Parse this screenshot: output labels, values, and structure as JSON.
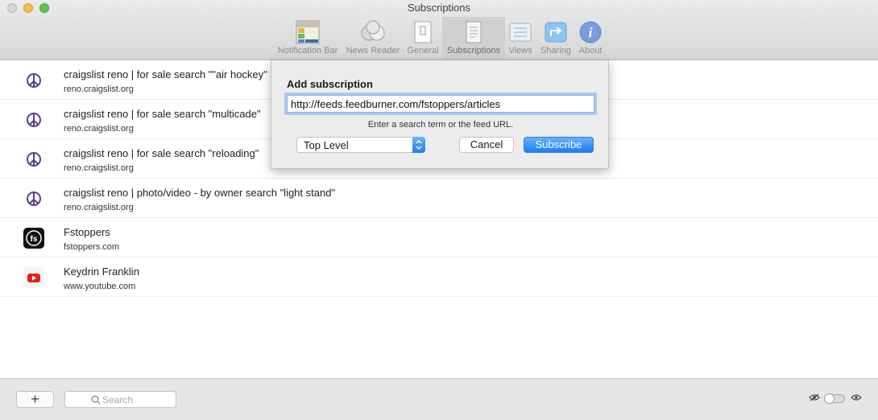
{
  "window": {
    "title": "Subscriptions"
  },
  "toolbar": {
    "items": [
      {
        "label": "Notification Bar",
        "icon": "notification-bar-icon"
      },
      {
        "label": "News Reader",
        "icon": "news-reader-icon"
      },
      {
        "label": "General",
        "icon": "general-icon"
      },
      {
        "label": "Subscriptions",
        "icon": "subscriptions-icon",
        "active": true
      },
      {
        "label": "Views",
        "icon": "views-icon"
      },
      {
        "label": "Sharing",
        "icon": "sharing-icon"
      },
      {
        "label": "About",
        "icon": "info-icon"
      }
    ]
  },
  "subscriptions": [
    {
      "title": "craigslist reno | for sale search \"\"air hockey\"",
      "domain": "reno.craigslist.org",
      "icon": "peace-icon"
    },
    {
      "title": "craigslist reno | for sale search \"multicade\"",
      "domain": "reno.craigslist.org",
      "icon": "peace-icon"
    },
    {
      "title": "craigslist reno | for sale search \"reloading\"",
      "domain": "reno.craigslist.org",
      "icon": "peace-icon"
    },
    {
      "title": "craigslist reno | photo/video - by owner search \"light stand\"",
      "domain": "reno.craigslist.org",
      "icon": "peace-icon"
    },
    {
      "title": "Fstoppers",
      "domain": "fstoppers.com",
      "icon": "fstoppers-icon"
    },
    {
      "title": "Keydrin Franklin",
      "domain": "www.youtube.com",
      "icon": "youtube-icon"
    }
  ],
  "dialog": {
    "title": "Add subscription",
    "url_value": "http://feeds.feedburner.com/fstoppers/articles",
    "hint": "Enter a search term or the feed URL.",
    "folder_selected": "Top Level",
    "cancel_label": "Cancel",
    "subscribe_label": "Subscribe"
  },
  "bottombar": {
    "add_label": "+",
    "search_placeholder": "Search"
  },
  "colors": {
    "accent": "#1b7df4",
    "peace": "#5b3e8c",
    "youtube": "#e62117"
  }
}
